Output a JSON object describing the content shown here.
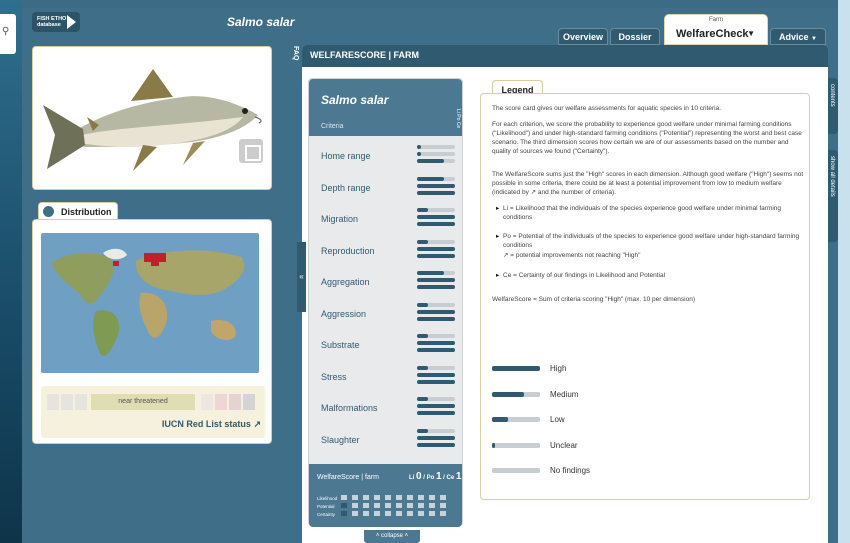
{
  "search": {
    "icon": "search-icon"
  },
  "app": {
    "species_title": "Salmo salar",
    "logo_text_line1": "FISH ETHO",
    "logo_text_line2": "database"
  },
  "tabs": [
    {
      "label": "Overview"
    },
    {
      "label": "Dossier"
    },
    {
      "label": "WelfareCheck",
      "sublabel": "Farm",
      "active": true
    },
    {
      "label": "Advice"
    }
  ],
  "distribution": {
    "title": "Distribution",
    "iucn_status": "near threatened",
    "iucn_link": "IUCN Red List status"
  },
  "faq": {
    "label": "FAQ"
  },
  "main": {
    "header": "WELFARESCORE | FARM",
    "sidetab_contents": "contents",
    "sidetab_details": "show all details"
  },
  "scorecard": {
    "species": "Salmo salar",
    "criteria_header": "Criteria",
    "criteria": [
      {
        "name": "Home range",
        "li": 0.1,
        "po": 0.1,
        "ce": 0.7,
        "unclear": true
      },
      {
        "name": "Depth range",
        "li": 0.7,
        "po": 1.0,
        "ce": 1.0
      },
      {
        "name": "Migration",
        "li": 0.3,
        "po": 1.0,
        "ce": 1.0
      },
      {
        "name": "Reproduction",
        "li": 0.3,
        "po": 1.0,
        "ce": 1.0
      },
      {
        "name": "Aggregation",
        "li": 0.7,
        "po": 1.0,
        "ce": 1.0
      },
      {
        "name": "Aggression",
        "li": 0.3,
        "po": 1.0,
        "ce": 1.0
      },
      {
        "name": "Substrate",
        "li": 0.3,
        "po": 1.0,
        "ce": 1.0
      },
      {
        "name": "Stress",
        "li": 0.3,
        "po": 1.0,
        "ce": 1.0
      },
      {
        "name": "Malformations",
        "li": 0.3,
        "po": 1.0,
        "ce": 1.0
      },
      {
        "name": "Slaughter",
        "li": 0.3,
        "po": 1.0,
        "ce": 1.0
      }
    ],
    "footer_title": "WelfareScore | farm",
    "footer_li_label": "Li",
    "footer_li": "0",
    "footer_po_label": "Po",
    "footer_po": "1",
    "footer_ce_label": "Ce",
    "footer_ce": "1",
    "footer_rows": [
      "Likelihood",
      "Potential",
      "Certainty"
    ],
    "collapse": "collapse"
  },
  "legend": {
    "tab": "Legend",
    "p1": "The score card gives our welfare assessments for aquatic species in 10 criteria.",
    "p2": "For each criterion, we score the probability to experience good welfare under minimal farming conditions (\"Likelihood\") and under high-standard farming conditions (\"Potential\") representing the worst and best case scenario. The third dimension scores how certain we are of our assessments based on the number and quality of sources we found (\"Certainty\").",
    "p3": "The WelfareScore sums just the \"High\" scores in each dimension. Although good welfare (\"High\") seems not possible in some criteria, there could be at least a potential improvement from low to medium welfare (indicated by ↗ and the number of criteria).",
    "li": "Li = Likelihood that the individuals of the species experience good welfare under minimal farming conditions",
    "po": "Po = Potential of the individuals of the species to experience good welfare under high-standard farming conditions",
    "po_note": "↗ = potential improvements not reaching \"High\"",
    "ce": "Ce = Certainty of our findings in Likelihood and Potential",
    "ws": "WelfareScore = Sum of criteria scoring \"High\" (max. 10 per dimension)",
    "levels": [
      {
        "label": "High",
        "value": 1.0
      },
      {
        "label": "Medium",
        "value": 0.66
      },
      {
        "label": "Low",
        "value": 0.33
      },
      {
        "label": "Unclear",
        "value": 0.06
      },
      {
        "label": "No findings",
        "value": 0
      }
    ]
  },
  "colors": {
    "primary": "#2f5a70",
    "accent_border": "#d8cfa0",
    "iucn_nt": "#dfddb2",
    "distribution": "#c0202a"
  }
}
